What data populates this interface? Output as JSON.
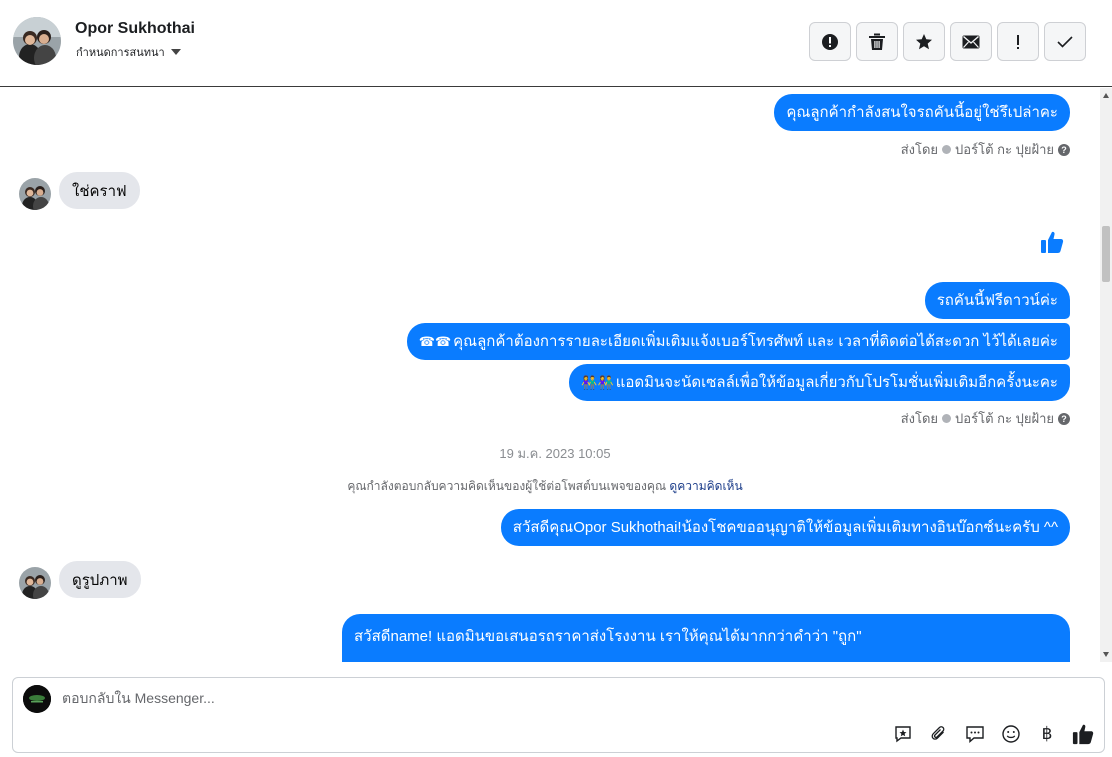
{
  "header": {
    "contact_name": "Opor Sukhothai",
    "label_dropdown": "กำหนดการสนทนา",
    "toolbar": [
      {
        "name": "spam-button",
        "icon": "exclamation-circle-icon"
      },
      {
        "name": "delete-button",
        "icon": "trash-icon"
      },
      {
        "name": "star-button",
        "icon": "star-icon"
      },
      {
        "name": "mark-unread-button",
        "icon": "envelope-icon"
      },
      {
        "name": "follow-up-button",
        "icon": "exclamation-icon"
      },
      {
        "name": "mark-done-button",
        "icon": "checkmark-icon"
      }
    ]
  },
  "conversation": {
    "messages": [
      {
        "from": "page",
        "text": "คุณลูกค้ากำลังสนใจรถคันนี้อยู่ใช่รึเปล่าคะ"
      },
      {
        "from": "page",
        "meta": "ส่งโดย",
        "sender": "ปอร์โต้ กะ ปุยฝ้าย"
      },
      {
        "from": "customer",
        "text": "ใช่คราฟ"
      },
      {
        "from": "page",
        "type": "like"
      },
      {
        "from": "page",
        "text": "รถคันนี้ฟรีดาวน์ค่ะ"
      },
      {
        "from": "page",
        "emoji": "☎☎",
        "text": "คุณลูกค้าต้องการรายละเอียดเพิ่มเติมแจ้งเบอร์โทรศัพท์ และ เวลาที่ติดต่อได้สะดวก ไว้ได้เลยค่ะ"
      },
      {
        "from": "page",
        "emoji": "👫👫",
        "text": "แอดมินจะนัดเซลล์เพื่อให้ข้อมูลเกี่ยวกับโปรโมชั่นเพิ่มเติมอีกครั้งนะคะ"
      },
      {
        "from": "page",
        "meta": "ส่งโดย",
        "sender": "ปอร์โต้ กะ ปุยฝ้าย"
      },
      {
        "type": "timestamp",
        "text": "19 ม.ค. 2023 10:05"
      },
      {
        "type": "system",
        "text": "คุณกำลังตอบกลับความคิดเห็นของผู้ใช้ต่อโพสต์บนเพจของคุณ",
        "link": "ดูความคิดเห็น"
      },
      {
        "from": "page",
        "text": "สวัสดีคุณOpor Sukhothai!น้องโชคขออนุญาติให้ข้อมูลเพิ่มเติมทางอินบ๊อกซ์นะครับ ^^"
      },
      {
        "from": "customer",
        "text": "ดูรูปภาพ"
      },
      {
        "from": "page",
        "text": "สวัสดีname! แอดมินขอเสนอรถราคาส่งโรงงาน เราให้คุณได้มากกว่าคำว่า \"ถูก\""
      }
    ]
  },
  "composer": {
    "placeholder": "ตอบกลับใน Messenger...",
    "tools": [
      "saved-reply-icon",
      "attachment-icon",
      "chat-bubble-icon",
      "emoji-icon",
      "baht-icon",
      "thumbs-up-icon"
    ],
    "baht_symbol": "฿"
  },
  "colors": {
    "accent": "#0a7cff",
    "incoming": "#e4e6eb",
    "meta": "#65676b"
  }
}
